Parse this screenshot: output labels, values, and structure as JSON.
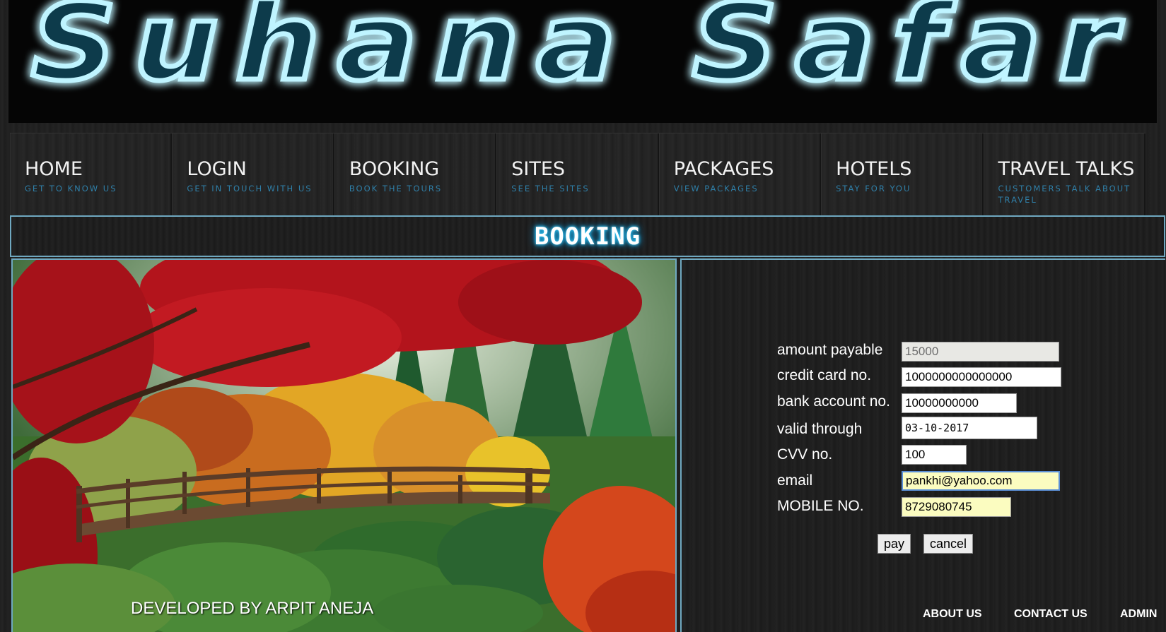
{
  "banner": {
    "title": "Suhana Safar"
  },
  "nav": [
    {
      "title": "HOME",
      "subtitle": "GET TO KNOW US"
    },
    {
      "title": "LOGIN",
      "subtitle": "GET IN TOUCH WITH US"
    },
    {
      "title": "BOOKING",
      "subtitle": "BOOK THE TOURS"
    },
    {
      "title": "SITES",
      "subtitle": "SEE THE SITES"
    },
    {
      "title": "PACKAGES",
      "subtitle": "VIEW PACKAGES"
    },
    {
      "title": "HOTELS",
      "subtitle": "STAY FOR YOU"
    },
    {
      "title": "TRAVEL TALKS",
      "subtitle": "CUSTOMERS TALK ABOUT TRAVEL"
    }
  ],
  "section": {
    "title": "BOOKING"
  },
  "form": {
    "amount_label": "amount payable",
    "amount_value": "15000",
    "card_label": "credit card no.",
    "card_value": "1000000000000000",
    "bank_label": "bank account no.",
    "bank_value": "10000000000",
    "valid_label": "valid through",
    "valid_value": "03-10-2017",
    "cvv_label": "CVV no.",
    "cvv_value": "100",
    "email_label": "email",
    "email_value": "pankhi@yahoo.com",
    "mobile_label": "MOBILE NO.",
    "mobile_value": "8729080745",
    "pay_label": "pay",
    "cancel_label": "cancel"
  },
  "developer": "DEVELOPED BY ARPIT ANEJA",
  "footer": {
    "about": "ABOUT US",
    "contact": "CONTACT US",
    "admin": "ADMIN"
  }
}
